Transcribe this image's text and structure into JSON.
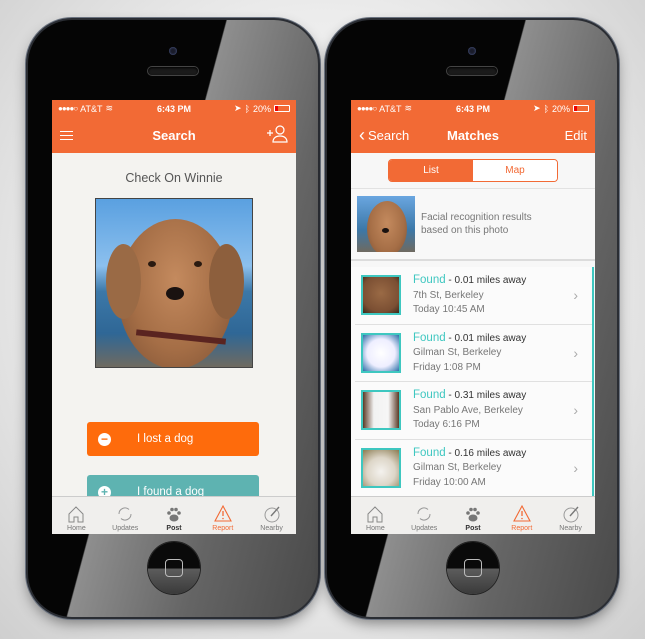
{
  "status_bar": {
    "carrier": "AT&T",
    "time": "6:43 PM",
    "battery": "20%"
  },
  "left_screen": {
    "nav": {
      "title": "Search",
      "menu_icon": "hamburger-menu-icon",
      "right_icon": "add-user-icon"
    },
    "check_title": "Check On Winnie",
    "buttons": {
      "lost": "I lost a dog",
      "found": "I found a dog"
    }
  },
  "right_screen": {
    "nav": {
      "back_label": "Search",
      "title": "Matches",
      "edit_label": "Edit"
    },
    "segments": {
      "list": "List",
      "map": "Map",
      "selected": "List"
    },
    "facial": {
      "line1": "Facial recognition results",
      "line2": "based on this photo"
    },
    "matches": [
      {
        "status": "Found",
        "distance": " - 0.01 miles away",
        "location": "7th St, Berkeley",
        "time": "Today 10:45 AM"
      },
      {
        "status": "Found",
        "distance": " - 0.01 miles away",
        "location": "Gilman St, Berkeley",
        "time": "Friday 1:08 PM"
      },
      {
        "status": "Found",
        "distance": " - 0.31 miles away",
        "location": "San Pablo Ave, Berkeley",
        "time": "Today 6:16 PM"
      },
      {
        "status": "Found",
        "distance": " - 0.16 miles away",
        "location": "Gilman St, Berkeley",
        "time": "Friday 10:00 AM"
      }
    ]
  },
  "tabbar": {
    "items": [
      {
        "label": "Home",
        "icon": "home-icon"
      },
      {
        "label": "Updates",
        "icon": "refresh-icon"
      },
      {
        "label": "Post",
        "icon": "paw-icon"
      },
      {
        "label": "Report",
        "icon": "warning-icon",
        "active": true
      },
      {
        "label": "Nearby",
        "icon": "compass-icon"
      }
    ]
  },
  "colors": {
    "brand_orange": "#f26a35",
    "lost_button": "#fe6b0c",
    "found_button": "#5eb3b1",
    "teal_accent": "#3ec7c0"
  }
}
